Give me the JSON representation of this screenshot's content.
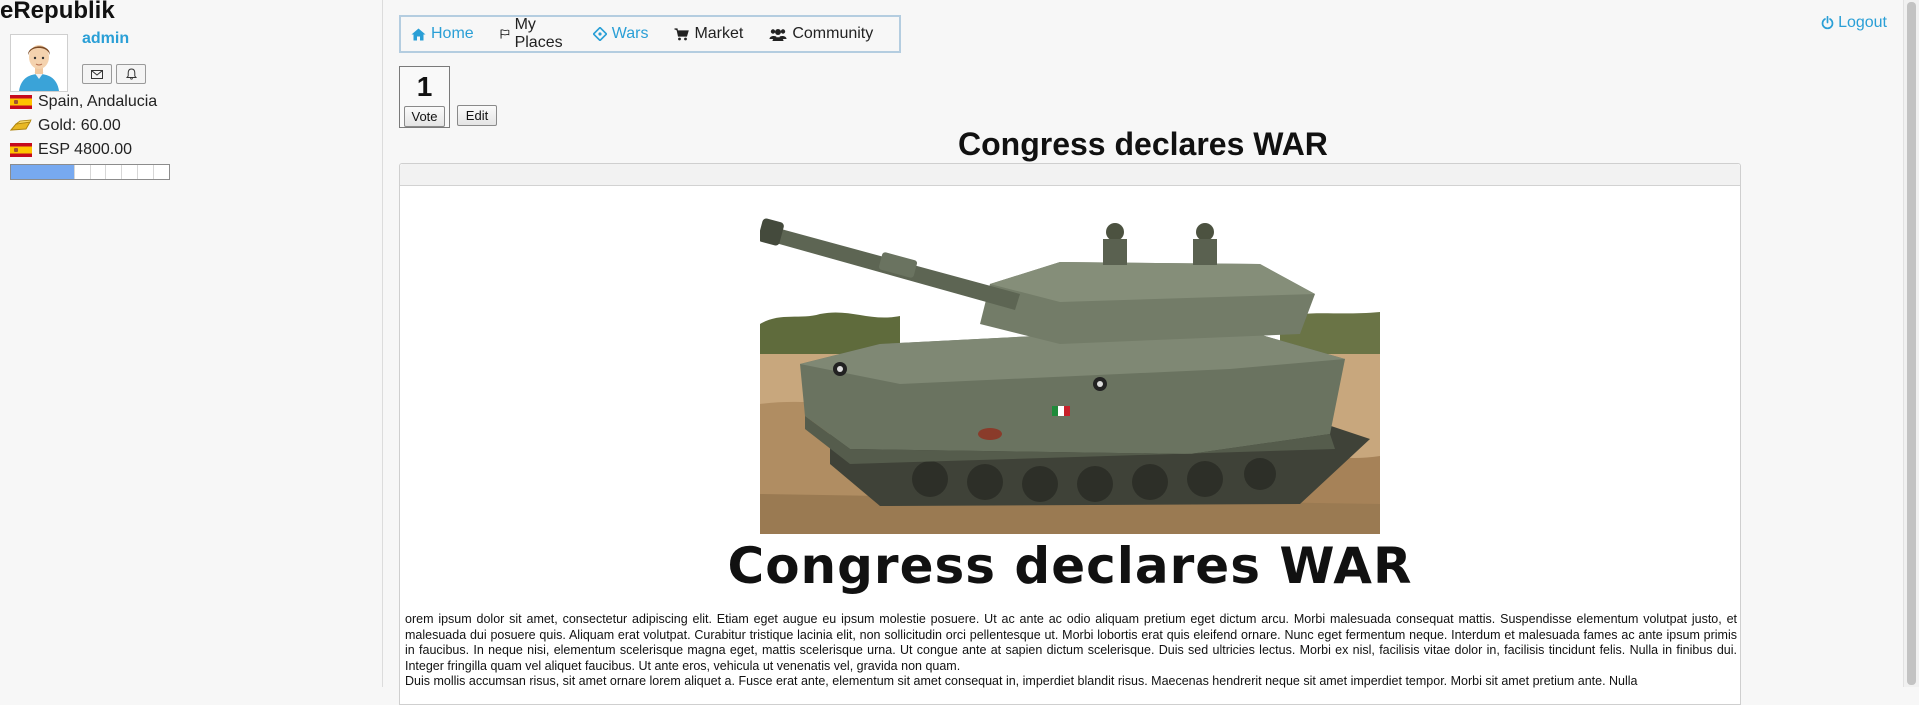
{
  "app": {
    "title": "eRepublik"
  },
  "user": {
    "name": "admin",
    "location": "Spain, Andalucia",
    "gold": "Gold: 60.00",
    "currency": "ESP 4800.00",
    "xp_progress": 0.4
  },
  "nav": {
    "items": [
      {
        "label": "Home",
        "icon": "home-icon",
        "color": "#2a9fd6"
      },
      {
        "label": "My Places",
        "icon": "flag-outline-icon",
        "color": "#222222"
      },
      {
        "label": "Wars",
        "icon": "crosshairs-icon",
        "color": "#2a9fd6"
      },
      {
        "label": "Market",
        "icon": "shopping-cart-icon",
        "color": "#222222"
      },
      {
        "label": "Community",
        "icon": "users-icon",
        "color": "#222222"
      }
    ],
    "logout": "Logout"
  },
  "article": {
    "votes": "1",
    "vote_label": "Vote",
    "edit_label": "Edit",
    "title": "Congress declares WAR",
    "headline": "Congress declares WAR",
    "paragraphs": [
      "orem ipsum dolor sit amet, consectetur adipiscing elit. Etiam eget augue eu ipsum molestie posuere. Ut ac ante ac odio aliquam pretium eget dictum arcu. Morbi malesuada consequat mattis. Suspendisse elementum volutpat justo, et malesuada dui posuere quis. Aliquam erat volutpat. Curabitur tristique lacinia elit, non sollicitudin orci pellentesque ut. Morbi lobortis erat quis eleifend ornare. Nunc eget fermentum neque. Interdum et malesuada fames ac ante ipsum primis in faucibus. In neque nisi, elementum scelerisque magna eget, mattis scelerisque urna. Ut congue ante at sapien dictum scelerisque. Duis sed ultricies lectus. Morbi ex nisl, facilisis vitae dolor in, facilisis tincidunt felis. Nulla in finibus dui. Integer fringilla quam vel aliquet faucibus. Ut ante eros, vehicula ut venenatis vel, gravida non quam.",
      "Duis mollis accumsan risus, sit amet ornare lorem aliquet a. Fusce erat ante, elementum sit amet consequat in, imperdiet blandit risus. Maecenas hendrerit neque sit amet imperdiet tempor. Morbi sit amet pretium ante. Nulla"
    ]
  },
  "colors": {
    "link": "#2a9fd6",
    "xp_fill": "#77a9f0",
    "nav_border": "#b4cde0"
  }
}
